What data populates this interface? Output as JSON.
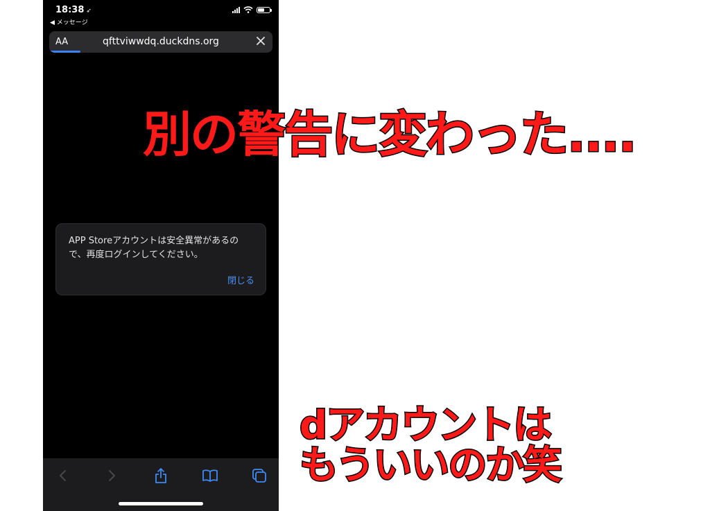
{
  "status_bar": {
    "time": "18:38",
    "back_label": "◀ メッセージ"
  },
  "url_bar": {
    "aa_label": "AA",
    "url": "qfttviwwdq.duckdns.org",
    "load_progress": 0.14
  },
  "alert": {
    "message": "APP Storeアカウントは安全異常があるので、再度ログインしてください。",
    "button_label": "閉じる"
  },
  "toolbar": {
    "icons": [
      "back-icon",
      "forward-icon",
      "share-icon",
      "bookmarks-icon",
      "tabs-icon"
    ]
  },
  "overlay": {
    "top_caption": "別の警告に変わった....",
    "bottom_caption_line1": "dアカウントは",
    "bottom_caption_line2": "もういいのか笑"
  },
  "colors": {
    "caption_red": "#ff1a1a",
    "link_blue": "#4a8ff5",
    "progress_blue": "#3b82f6"
  }
}
